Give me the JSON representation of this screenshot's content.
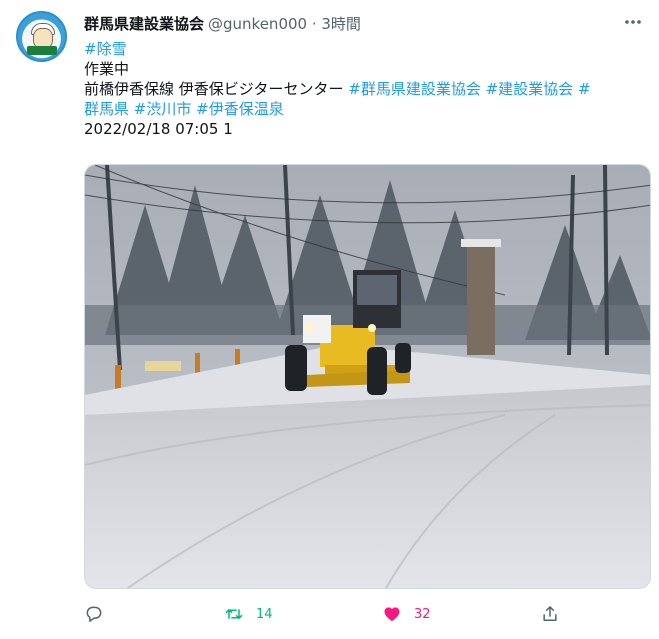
{
  "tweet": {
    "display_name": "群馬県建設業協会",
    "handle_time": "@gunken000 · 3時間",
    "lines": [
      {
        "segments": [
          {
            "text": "#除雪",
            "tag": true
          }
        ]
      },
      {
        "segments": [
          {
            "text": "作業中",
            "tag": false
          }
        ]
      },
      {
        "segments": [
          {
            "text": "前橋伊香保線 伊香保ビジターセンター ",
            "tag": false
          },
          {
            "text": "#群馬県建設業協会",
            "tag": true
          },
          {
            "text": " ",
            "tag": false
          },
          {
            "text": "#建設業協会",
            "tag": true
          },
          {
            "text": " ",
            "tag": false
          },
          {
            "text": "#",
            "tag": true
          }
        ]
      },
      {
        "segments": [
          {
            "text": "群馬県",
            "tag": true
          },
          {
            "text": " ",
            "tag": false
          },
          {
            "text": "#渋川市",
            "tag": true
          },
          {
            "text": " ",
            "tag": false
          },
          {
            "text": "#伊香保温泉",
            "tag": true
          }
        ]
      },
      {
        "segments": [
          {
            "text": "2022/02/18 07:05 1",
            "tag": false
          }
        ]
      }
    ],
    "photo_alt": "snow plow grader clearing a snowy road"
  },
  "actions": {
    "reply": {
      "icon": "reply-icon",
      "count": ""
    },
    "retweet": {
      "icon": "retweet-icon",
      "count": "14",
      "color": "#00ba7c"
    },
    "like": {
      "icon": "heart-icon",
      "count": "32",
      "color": "#f91880"
    },
    "share": {
      "icon": "share-icon",
      "count": ""
    }
  },
  "colors": {
    "link": "#1d9bf0",
    "secondary": "#536471"
  }
}
